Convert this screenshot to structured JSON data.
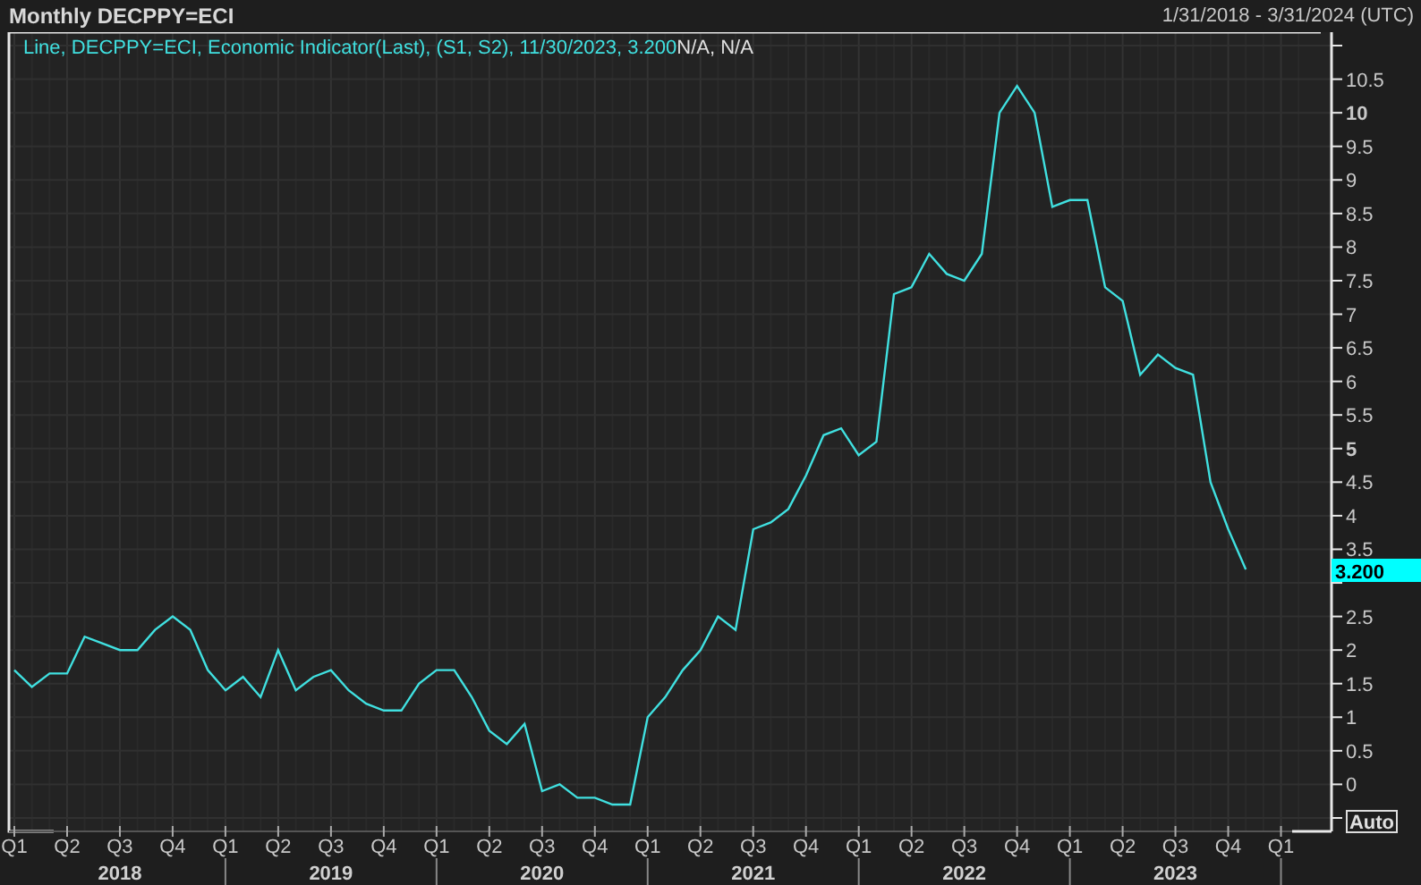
{
  "header": {
    "title": "Monthly DECPPY=ECI",
    "date_range": "1/31/2018 - 3/31/2024 (UTC)"
  },
  "legend": {
    "prefix": "Line, ",
    "suffix": ", Economic Indicator(Last), (S1, S2), 11/30/2023, 3.200",
    "extra_text": "N/A, N/A"
  },
  "last_value_label": "3.200",
  "auto_button": "Auto",
  "quarters": [
    "Q1",
    "Q2",
    "Q3",
    "Q4",
    "Q1",
    "Q2",
    "Q3",
    "Q4",
    "Q1",
    "Q2",
    "Q3",
    "Q4",
    "Q1",
    "Q2",
    "Q3",
    "Q4",
    "Q1",
    "Q2",
    "Q3",
    "Q4",
    "Q1",
    "Q2",
    "Q3",
    "Q4",
    "Q1"
  ],
  "years": [
    "2018",
    "2019",
    "2020",
    "2021",
    "2022",
    "2023"
  ],
  "chart": {
    "chart_data": {
      "type": "line",
      "grid": true,
      "ylim": [
        -0.7,
        11.2
      ],
      "yticks": [
        {
          "value": 0,
          "label": "0"
        },
        {
          "value": 0.5,
          "label": "0.5"
        },
        {
          "value": 1,
          "label": "1"
        },
        {
          "value": 1.5,
          "label": "1.5"
        },
        {
          "value": 2,
          "label": "2"
        },
        {
          "value": 2.5,
          "label": "2.5"
        },
        {
          "value": 3.5,
          "label": "3.5"
        },
        {
          "value": 4,
          "label": "4"
        },
        {
          "value": 4.5,
          "label": "4.5"
        },
        {
          "value": 5,
          "label": "5"
        },
        {
          "value": 5.5,
          "label": "5.5"
        },
        {
          "value": 6,
          "label": "6"
        },
        {
          "value": 6.5,
          "label": "6.5"
        },
        {
          "value": 7,
          "label": "7"
        },
        {
          "value": 7.5,
          "label": "7.5"
        },
        {
          "value": 8,
          "label": "8"
        },
        {
          "value": 8.5,
          "label": "8.5"
        },
        {
          "value": 9,
          "label": "9"
        },
        {
          "value": 9.5,
          "label": "9.5"
        },
        {
          "value": 10,
          "label": "10"
        },
        {
          "value": 10.5,
          "label": "10.5"
        }
      ],
      "series": [
        {
          "name": "DECPPY=ECI",
          "color": "#40e0e0",
          "values": [
            1.7,
            1.45,
            1.65,
            1.65,
            2.2,
            2.1,
            2.0,
            2.0,
            2.3,
            2.5,
            2.3,
            1.7,
            1.4,
            1.6,
            1.3,
            2.0,
            1.4,
            1.6,
            1.7,
            1.4,
            1.2,
            1.1,
            1.1,
            1.5,
            1.7,
            1.7,
            1.3,
            0.8,
            0.6,
            0.9,
            -0.1,
            0.0,
            -0.2,
            -0.2,
            -0.3,
            -0.3,
            1.0,
            1.3,
            1.7,
            2.0,
            2.5,
            2.3,
            3.8,
            3.9,
            4.1,
            4.6,
            5.2,
            5.3,
            4.9,
            5.1,
            7.3,
            7.4,
            7.9,
            7.6,
            7.5,
            7.9,
            10.0,
            10.4,
            10.0,
            8.6,
            8.7,
            8.7,
            7.4,
            7.2,
            6.1,
            6.4,
            6.2,
            6.1,
            4.5,
            3.8,
            3.2
          ]
        }
      ]
    }
  }
}
